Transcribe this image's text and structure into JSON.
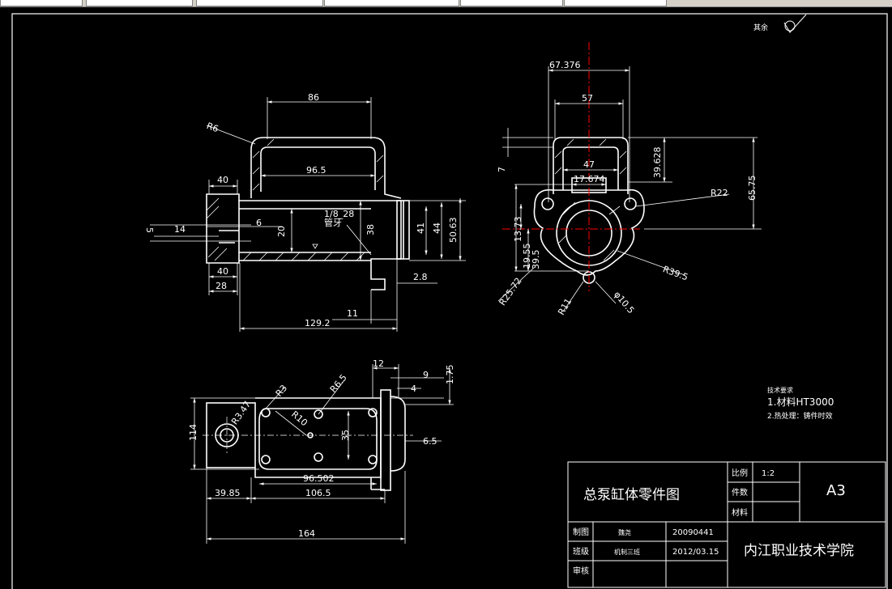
{
  "dimensions": {
    "d86": "86",
    "r6": "R6",
    "d96_5": "96.5",
    "d40a": "40",
    "d6": "6",
    "d14": "14",
    "d5": "5",
    "d20": "20",
    "pipe": "1/8_28",
    "pipe2": "管牙",
    "d38": "38",
    "d41": "41",
    "d44": "44",
    "d50_63": "50.63",
    "d40b": "40",
    "d28": "28",
    "d2_8": "2.8",
    "d11": "11",
    "d129_2": "129.2",
    "d67_376": "67.376",
    "d57": "57",
    "d47": "47",
    "d17_674": "17.674",
    "d7": "7",
    "d39_628": "39.628",
    "d65_75": "65.75",
    "r22": "R22",
    "d13_73": "13.73",
    "d19_55": "19.55",
    "d39_5": "39.5",
    "r39_5": "R39.5",
    "r25_72": "R25.72",
    "r11": "R11",
    "phi10_5": "φ10.5",
    "d12": "12",
    "d9": "9",
    "d1_75": "1.75",
    "d4": "4",
    "r3": "R3",
    "r6_5": "R6.5",
    "r3_47": "R3.47",
    "r10": "R10",
    "d35": "35",
    "d114": "114",
    "d6_5": "6.5",
    "d96_502": "96.502",
    "d39_85": "39.85",
    "d106_5": "106.5",
    "d164": "164"
  },
  "notes": {
    "title": "技术要求",
    "item1": "1.材料HT3000",
    "item2": "2.热处理：铸件时效",
    "roughness": "其余"
  },
  "title_block": {
    "drawing_name": "总泵缸体零件图",
    "scale_label": "比例",
    "scale_value": "1:2",
    "pieces_label": "件数",
    "material_label": "材料",
    "sheet_size": "A3",
    "drafter_label": "制图",
    "drafter_name": "魏尧",
    "drafter_id": "20090441",
    "class_label": "班级",
    "class_name": "机制三班",
    "date": "2012/03.15",
    "reviewer_label": "审核",
    "school": "内江职业技术学院"
  },
  "colors": {
    "line": "#ffffff",
    "center": "#ff0000",
    "background": "#000000"
  }
}
